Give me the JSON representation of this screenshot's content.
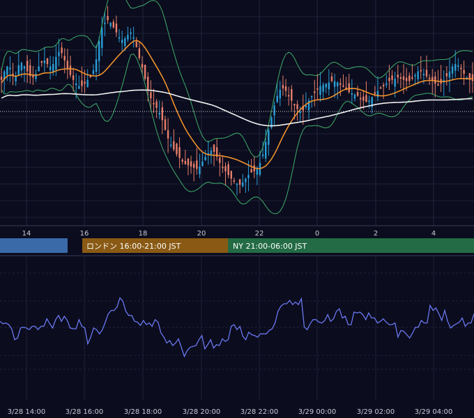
{
  "chart_data": [
    {
      "type": "candlestick",
      "name": "price-panel",
      "x_axis": {
        "ticks": [
          "14",
          "16",
          "18",
          "20",
          "22",
          "0",
          "2",
          "4"
        ]
      },
      "grid": true,
      "indicators": [
        "bollinger-bands",
        "moving-average-orange",
        "moving-average-white",
        "dotted-reference-line"
      ],
      "colors": {
        "up": "#2a9fd8",
        "down": "#e8806a",
        "bb": "#3fae6a",
        "ma_orange": "#f0922b",
        "ma_white": "#f2f2f2",
        "background": "#0b0c1e"
      },
      "values": [
        0.23,
        0.3,
        0.34,
        0.33,
        0.27,
        0.26,
        0.35,
        0.37,
        0.34,
        0.3,
        0.26,
        0.25,
        0.28,
        0.34,
        0.38,
        0.39,
        0.36,
        0.34,
        0.36,
        0.42,
        0.46,
        0.45,
        0.39,
        0.32,
        0.27,
        0.23,
        0.2,
        0.18,
        0.18,
        0.2,
        0.23,
        0.26,
        0.31,
        0.4,
        0.55,
        0.66,
        0.7,
        0.72,
        0.7,
        0.66,
        0.62,
        0.58,
        0.56,
        0.57,
        0.6,
        0.62,
        0.58,
        0.5,
        0.41,
        0.33,
        0.24,
        0.15,
        0.08,
        0.04,
        0.0,
        -0.04,
        -0.1,
        -0.18,
        -0.25,
        -0.3,
        -0.34,
        -0.38,
        -0.41,
        -0.44,
        -0.46,
        -0.47,
        -0.48,
        -0.49,
        -0.5,
        -0.48,
        -0.44,
        -0.4,
        -0.37,
        -0.35,
        -0.36,
        -0.4,
        -0.45,
        -0.49,
        -0.52,
        -0.55,
        -0.58,
        -0.6,
        -0.62,
        -0.63,
        -0.61,
        -0.58,
        -0.55,
        -0.53,
        -0.52,
        -0.5,
        -0.45,
        -0.38,
        -0.28,
        -0.18,
        -0.08,
        0.02,
        0.1,
        0.15,
        0.16,
        0.14,
        0.1,
        0.06,
        0.02,
        -0.01,
        -0.03,
        -0.02,
        0.02,
        0.06,
        0.1,
        0.13,
        0.16,
        0.18,
        0.19,
        0.2,
        0.21,
        0.22,
        0.22,
        0.21,
        0.2,
        0.18,
        0.15,
        0.13,
        0.12,
        0.11,
        0.1,
        0.08,
        0.06,
        0.05,
        0.06,
        0.09,
        0.12,
        0.14,
        0.16,
        0.18,
        0.2,
        0.22,
        0.23,
        0.24,
        0.25,
        0.24,
        0.23,
        0.22,
        0.22,
        0.24,
        0.27,
        0.3,
        0.3,
        0.28,
        0.26,
        0.24,
        0.22,
        0.2,
        0.19,
        0.2,
        0.23,
        0.26,
        0.3,
        0.34,
        0.36,
        0.35,
        0.32,
        0.28,
        0.25,
        0.23,
        0.22
      ]
    },
    {
      "type": "line",
      "name": "oscillator-panel",
      "x_axis": {
        "ticks": [
          "3/28 14:00",
          "3/28 16:00",
          "3/28 18:00",
          "3/28 20:00",
          "3/28 22:00",
          "3/29 00:00",
          "3/29 02:00",
          "3/29 04:00"
        ]
      },
      "grid": true,
      "colors": {
        "line": "#6a78f0"
      },
      "values": [
        0.49,
        0.46,
        0.47,
        0.45,
        0.4,
        0.27,
        0.29,
        0.41,
        0.42,
        0.41,
        0.39,
        0.43,
        0.43,
        0.39,
        0.43,
        0.43,
        0.52,
        0.46,
        0.41,
        0.51,
        0.56,
        0.49,
        0.55,
        0.5,
        0.41,
        0.4,
        0.4,
        0.51,
        0.43,
        0.41,
        0.22,
        0.3,
        0.41,
        0.39,
        0.34,
        0.39,
        0.48,
        0.58,
        0.62,
        0.62,
        0.66,
        0.77,
        0.73,
        0.61,
        0.56,
        0.56,
        0.49,
        0.48,
        0.44,
        0.5,
        0.45,
        0.47,
        0.43,
        0.51,
        0.48,
        0.35,
        0.3,
        0.23,
        0.26,
        0.2,
        0.23,
        0.28,
        0.18,
        0.07,
        0.14,
        0.18,
        0.19,
        0.2,
        0.27,
        0.32,
        0.16,
        0.21,
        0.27,
        0.17,
        0.21,
        0.2,
        0.28,
        0.25,
        0.27,
        0.43,
        0.45,
        0.39,
        0.43,
        0.31,
        0.27,
        0.36,
        0.33,
        0.32,
        0.3,
        0.34,
        0.34,
        0.34,
        0.38,
        0.4,
        0.47,
        0.61,
        0.67,
        0.7,
        0.7,
        0.74,
        0.69,
        0.72,
        0.69,
        0.76,
        0.42,
        0.39,
        0.46,
        0.51,
        0.51,
        0.48,
        0.47,
        0.5,
        0.57,
        0.49,
        0.52,
        0.61,
        0.64,
        0.53,
        0.55,
        0.45,
        0.45,
        0.6,
        0.59,
        0.6,
        0.57,
        0.51,
        0.59,
        0.53,
        0.53,
        0.47,
        0.49,
        0.52,
        0.48,
        0.45,
        0.45,
        0.47,
        0.3,
        0.38,
        0.37,
        0.33,
        0.29,
        0.35,
        0.42,
        0.42,
        0.5,
        0.47,
        0.47,
        0.68,
        0.62,
        0.65,
        0.58,
        0.5,
        0.62,
        0.49,
        0.41,
        0.44,
        0.46,
        0.48,
        0.53,
        0.43,
        0.47,
        0.47,
        0.58
      ]
    }
  ],
  "sessions": [
    {
      "label": "",
      "color": "#3a6aa8"
    },
    {
      "label": "ロンドン 16:00-21:00 JST",
      "color": "#8a5a14"
    },
    {
      "label": "NY 21:00-06:00 JST",
      "color": "#236b45"
    }
  ]
}
